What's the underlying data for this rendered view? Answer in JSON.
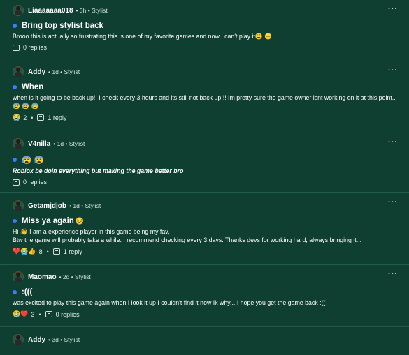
{
  "posts": [
    {
      "username": "Liaaaaaaa018",
      "meta": "• 3h • Stylist",
      "title": "Bring top stylist back",
      "title_emoji": "",
      "body": "Brooo this is actually so frustrating this is one of my favorite games and now I can't play it😩 😞",
      "reactions": "",
      "reaction_count": "",
      "replies": "0 replies"
    },
    {
      "username": "Addy",
      "meta": "• 1d • Stylist",
      "title": "When",
      "title_emoji": "",
      "body": "when is it going to be back up!! I check every 3 hours and its still not back up!!! Im pretty sure the game owner isnt working on it at this point..😰 😰 😰",
      "reactions": "😭",
      "reaction_count": "2",
      "replies": "1 reply"
    },
    {
      "username": "V4nilla",
      "meta": "• 1d • Stylist",
      "title": "😰 😰",
      "title_emoji": "",
      "body": "Roblox be doin everything but making the game better bro",
      "reactions": "",
      "reaction_count": "",
      "replies": "0 replies"
    },
    {
      "username": "Getamjdjob",
      "meta": "• 1d • Stylist",
      "title": "Miss ya again",
      "title_emoji": "😔",
      "body": "Hi 👋 I am a experience player in this game being my fav,\nBtw the game will probably take a while. I recommend checking every 3 days. Thanks devs for working hard, always bringing it...",
      "reactions": "❤️😭👍",
      "reaction_count": "8",
      "replies": "1 reply"
    },
    {
      "username": "Maomao",
      "meta": "• 2d • Stylist",
      "title": ":(((",
      "title_emoji": "",
      "body": "was excited to play this game again when I look it up I couldn't find it now Ik why... I hope you get the game back :((",
      "reactions": "😭❤️",
      "reaction_count": "3",
      "replies": "0 replies"
    },
    {
      "username": "Addy",
      "meta": "• 3d • Stylist",
      "title": "",
      "title_emoji": "",
      "body": "",
      "reactions": "",
      "reaction_count": "",
      "replies": ""
    }
  ],
  "more_label": "···",
  "colors": {
    "background": "#0e3f30",
    "divider": "#1f5a47",
    "bullet": "#3c7cff"
  }
}
